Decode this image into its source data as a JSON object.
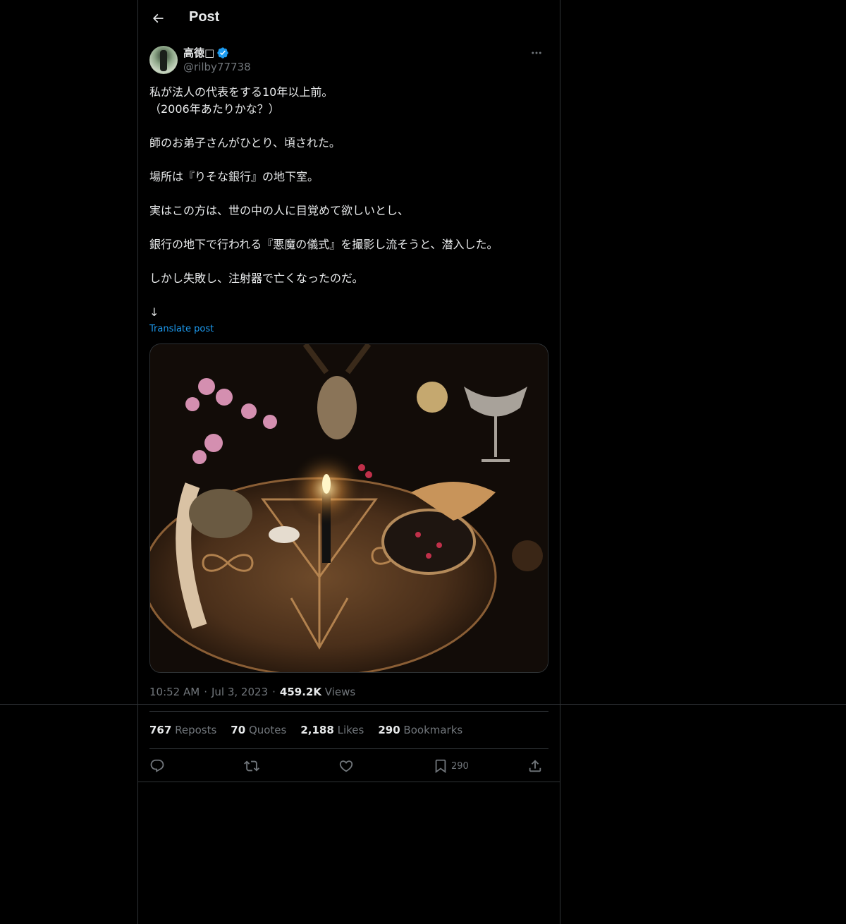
{
  "header": {
    "title": "Post"
  },
  "author": {
    "display_name": "高徳□",
    "handle": "@rilby77738",
    "verified": true
  },
  "post": {
    "lines": [
      "私が法人の代表をする10年以上前。",
      "（2006年あたりかな？）",
      "",
      "師のお弟子さんがひとり、頃された。",
      "",
      "場所は『りそな銀行』の地下室。",
      "",
      "実はこの方は、世の中の人に目覚めて欲しいとし、",
      "",
      "銀行の地下で行われる『悪魔の儀式』を撮影し流そうと、潜入した。",
      "",
      "しかし失敗し、注射器で亡くなったのだ。",
      "",
      "↓"
    ],
    "translate_label": "Translate post"
  },
  "meta": {
    "time": "10:52 AM",
    "date": "Jul 3, 2023",
    "views_count": "459.2K",
    "views_label": "Views"
  },
  "stats": [
    {
      "num": "767",
      "label": "Reposts"
    },
    {
      "num": "70",
      "label": "Quotes"
    },
    {
      "num": "2,188",
      "label": "Likes"
    },
    {
      "num": "290",
      "label": "Bookmarks"
    }
  ],
  "actions": {
    "bookmark_count": "290"
  },
  "colors": {
    "background": "#000000",
    "text": "#e7e9ea",
    "muted": "#71767b",
    "link": "#1d9bf0",
    "border": "#2f3336",
    "verified": "#1d9bf0"
  }
}
